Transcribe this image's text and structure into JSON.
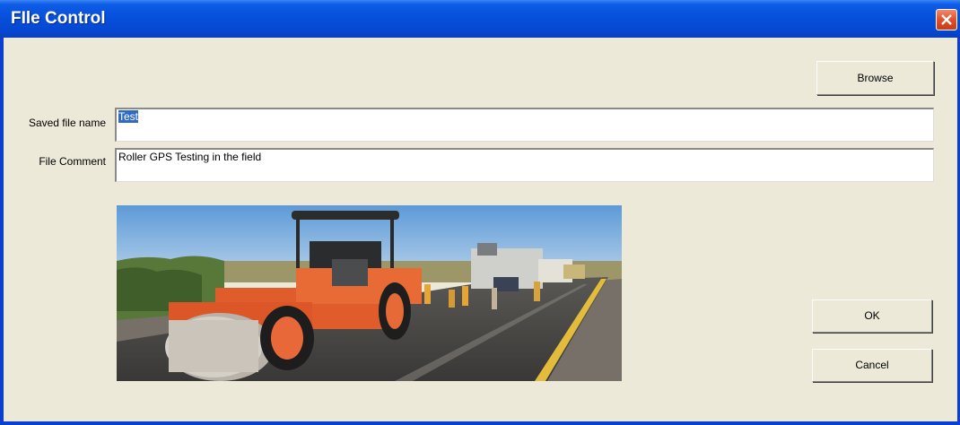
{
  "window": {
    "title": "FIle Control"
  },
  "browse_button": {
    "label": "Browse"
  },
  "saved_file": {
    "label": "Saved file name",
    "value": "Test"
  },
  "comment": {
    "label": "File Comment",
    "value": "Roller GPS Testing in the field"
  },
  "ok_button": {
    "label": "OK"
  },
  "cancel_button": {
    "label": "Cancel"
  },
  "image": {
    "subject": "road-roller-paving-photo"
  }
}
